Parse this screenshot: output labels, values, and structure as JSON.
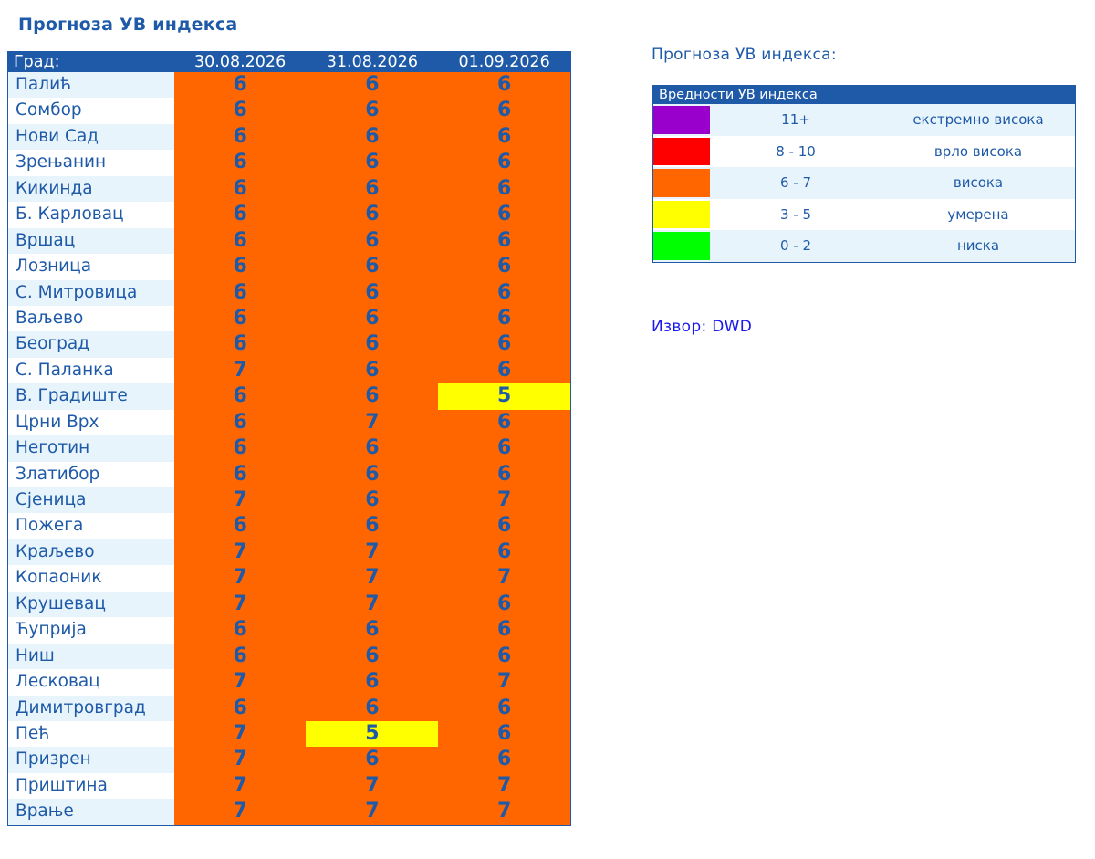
{
  "title": "Прогноза УВ индекса",
  "table": {
    "city_header": "Град:",
    "dates": [
      "30.08.2026",
      "31.08.2026",
      "01.09.2026"
    ],
    "rows": [
      {
        "city": "Палић",
        "v": [
          "6",
          "6",
          "6"
        ]
      },
      {
        "city": "Сомбор",
        "v": [
          "6",
          "6",
          "6"
        ]
      },
      {
        "city": "Нови Сад",
        "v": [
          "6",
          "6",
          "6"
        ]
      },
      {
        "city": "Зрењанин",
        "v": [
          "6",
          "6",
          "6"
        ]
      },
      {
        "city": "Кикинда",
        "v": [
          "6",
          "6",
          "6"
        ]
      },
      {
        "city": "Б. Карловац",
        "v": [
          "6",
          "6",
          "6"
        ]
      },
      {
        "city": "Вршац",
        "v": [
          "6",
          "6",
          "6"
        ]
      },
      {
        "city": "Лозница",
        "v": [
          "6",
          "6",
          "6"
        ]
      },
      {
        "city": "С. Митровица",
        "v": [
          "6",
          "6",
          "6"
        ]
      },
      {
        "city": "Ваљево",
        "v": [
          "6",
          "6",
          "6"
        ]
      },
      {
        "city": "Београд",
        "v": [
          "6",
          "6",
          "6"
        ]
      },
      {
        "city": "С. Паланка",
        "v": [
          "7",
          "6",
          "6"
        ]
      },
      {
        "city": "В. Градиште",
        "v": [
          "6",
          "6",
          "5"
        ]
      },
      {
        "city": "Црни Врх",
        "v": [
          "6",
          "7",
          "6"
        ]
      },
      {
        "city": "Неготин",
        "v": [
          "6",
          "6",
          "6"
        ]
      },
      {
        "city": "Златибор",
        "v": [
          "6",
          "6",
          "6"
        ]
      },
      {
        "city": "Сјеница",
        "v": [
          "7",
          "6",
          "7"
        ]
      },
      {
        "city": "Пожега",
        "v": [
          "6",
          "6",
          "6"
        ]
      },
      {
        "city": "Краљево",
        "v": [
          "7",
          "7",
          "6"
        ]
      },
      {
        "city": "Копаоник",
        "v": [
          "7",
          "7",
          "7"
        ]
      },
      {
        "city": "Крушевац",
        "v": [
          "7",
          "7",
          "6"
        ]
      },
      {
        "city": "Ћуприја",
        "v": [
          "6",
          "6",
          "6"
        ]
      },
      {
        "city": "Ниш",
        "v": [
          "6",
          "6",
          "6"
        ]
      },
      {
        "city": "Лесковац",
        "v": [
          "7",
          "6",
          "7"
        ]
      },
      {
        "city": "Димитровград",
        "v": [
          "6",
          "6",
          "6"
        ]
      },
      {
        "city": "Пећ",
        "v": [
          "7",
          "5",
          "6"
        ]
      },
      {
        "city": "Призрен",
        "v": [
          "7",
          "6",
          "6"
        ]
      },
      {
        "city": "Приштина",
        "v": [
          "7",
          "7",
          "7"
        ]
      },
      {
        "city": "Врање",
        "v": [
          "7",
          "7",
          "7"
        ]
      }
    ]
  },
  "legend": {
    "caption": "Прогноза УВ индекса:",
    "header": "Вредности УВ индекса",
    "items": [
      {
        "range": "11+",
        "label": "екстремно висока",
        "color": "#9900cc"
      },
      {
        "range": "8 - 10",
        "label": "врло висока",
        "color": "#ff0000"
      },
      {
        "range": "6 - 7",
        "label": "висока",
        "color": "#ff6600"
      },
      {
        "range": "3 - 5",
        "label": "умерена",
        "color": "#ffff00"
      },
      {
        "range": "0 - 2",
        "label": "ниска",
        "color": "#00ff00"
      }
    ]
  },
  "source": "Извор: DWD",
  "colors": {
    "accent": "#1e5aa8",
    "high": "#ff6600",
    "moderate": "#ffff00"
  }
}
